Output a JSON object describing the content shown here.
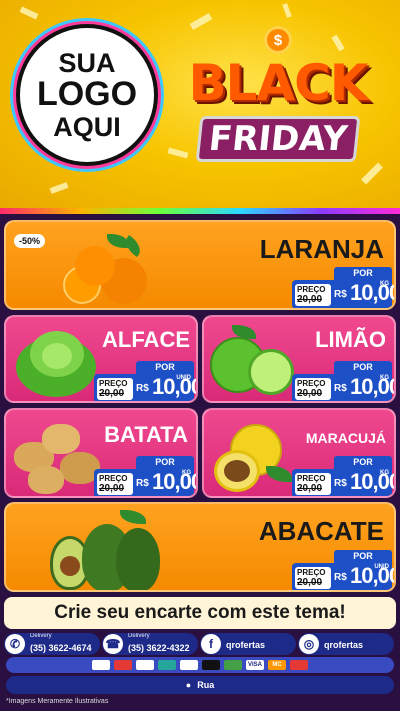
{
  "header": {
    "logo_line1": "SUA",
    "logo_line2": "LOGO",
    "logo_line3": "AQUI",
    "badge_top": "BLACK",
    "badge_bottom": "FRIDAY",
    "coin": "$"
  },
  "products": [
    {
      "name": "LARANJA",
      "discount": "-50%",
      "preco": "PREÇO",
      "por": "POR",
      "old": "20,00",
      "currency": "R$",
      "price": "10,00",
      "unit": "KG"
    },
    {
      "name": "ALFACE",
      "preco": "PREÇO",
      "por": "POR",
      "old": "20,00",
      "currency": "R$",
      "price": "10,00",
      "unit": "UNID"
    },
    {
      "name": "LIMÃO",
      "preco": "PREÇO",
      "por": "POR",
      "old": "20,00",
      "currency": "R$",
      "price": "10,00",
      "unit": "KG"
    },
    {
      "name": "BATATA",
      "preco": "PREÇO",
      "por": "POR",
      "old": "20,00",
      "currency": "R$",
      "price": "10,00",
      "unit": "KG"
    },
    {
      "name": "MARACUJÁ",
      "preco": "PREÇO",
      "por": "POR",
      "old": "20,00",
      "currency": "R$",
      "price": "10,00",
      "unit": "KG"
    },
    {
      "name": "ABACATE",
      "preco": "PREÇO",
      "por": "POR",
      "old": "20,00",
      "currency": "R$",
      "price": "10,00",
      "unit": "UNID"
    }
  ],
  "banner": "Crie seu encarte com este tema!",
  "footer": {
    "whatsapp_label": "Delivery",
    "whatsapp_number": "(35) 3622-4674",
    "phone_label": "Delivery",
    "phone_number": "(35) 3622-4322",
    "facebook": "qrofertas",
    "instagram": "qrofertas",
    "address": "Rua",
    "disclaimer": "*Imagens Meramente Ilustrativas",
    "payments": [
      "VISA",
      "MC"
    ]
  },
  "colors": {
    "orange_card": "#f58a00",
    "pink_card": "#d92a78",
    "price_blue": "#1d4fc7",
    "footer_blue": "#1e2a88"
  }
}
